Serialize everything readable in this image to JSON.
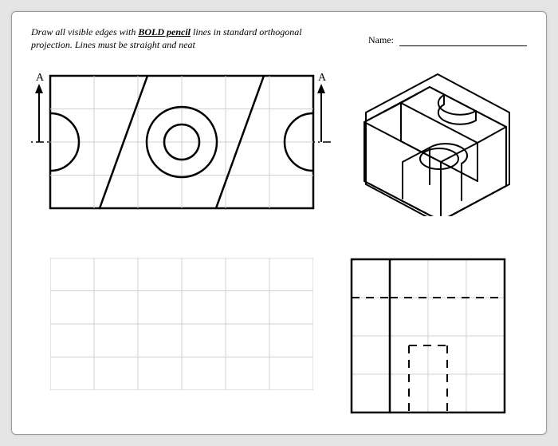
{
  "header": {
    "instruction_prefix": "Draw all visible edges with ",
    "instruction_bold": "BOLD pencil",
    "instruction_suffix": " lines in standard orthogonal projection. Lines must be straight and neat",
    "name_label": "Name:"
  },
  "labels": {
    "section_A_left": "A",
    "section_A_right": "A"
  },
  "diagram": {
    "views": [
      "top",
      "isometric",
      "front_blank",
      "side"
    ],
    "top_grid": {
      "cols": 6,
      "rows": 4
    },
    "front_grid": {
      "cols": 6,
      "rows": 4
    },
    "side_grid": {
      "cols": 4,
      "rows": 4
    }
  }
}
